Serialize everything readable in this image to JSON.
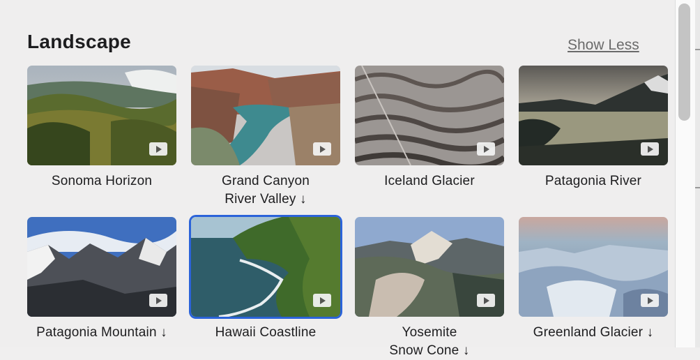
{
  "section": {
    "title": "Landscape",
    "toggle_label": "Show Less"
  },
  "items": [
    {
      "name": "Sonoma Horizon",
      "line2": ""
    },
    {
      "name": "Grand Canyon",
      "line2": "River Valley ↓"
    },
    {
      "name": "Iceland Glacier",
      "line2": ""
    },
    {
      "name": "Patagonia River",
      "line2": ""
    },
    {
      "name": "Patagonia Mountain ↓",
      "line2": ""
    },
    {
      "name": "Hawaii Coastline",
      "line2": "",
      "selected": true
    },
    {
      "name": "Yosemite",
      "line2": "Snow Cone ↓"
    },
    {
      "name": "Greenland Glacier ↓",
      "line2": ""
    }
  ],
  "colors": {
    "selection": "#2b63d9",
    "background": "#efeeee"
  }
}
